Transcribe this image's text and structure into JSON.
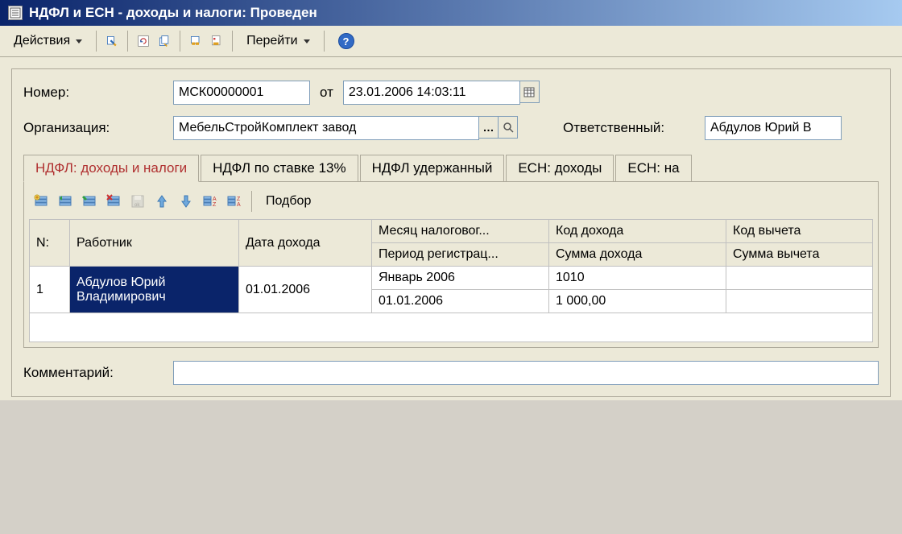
{
  "window": {
    "title": "НДФЛ и ЕСН - доходы и налоги: Проведен"
  },
  "toolbar": {
    "actions_label": "Действия",
    "goto_label": "Перейти"
  },
  "fields": {
    "number_label": "Номер:",
    "number_value": "МСК00000001",
    "from_label": "от",
    "date_value": "23.01.2006 14:03:11",
    "org_label": "Организация:",
    "org_value": "МебельСтройКомплект завод",
    "responsible_label": "Ответственный:",
    "responsible_value": "Абдулов Юрий В",
    "comment_label": "Комментарий:",
    "comment_value": ""
  },
  "tabs": {
    "tab1": "НДФЛ: доходы и налоги",
    "tab2": "НДФЛ по ставке 13%",
    "tab3": "НДФЛ удержанный",
    "tab4": "ЕСН: доходы",
    "tab5": "ЕСН: на"
  },
  "table_toolbar": {
    "select_label": "Подбор"
  },
  "table": {
    "headers": {
      "num": "N:",
      "employee": "Работник",
      "income_date": "Дата дохода",
      "tax_month": "Месяц налоговог...",
      "reg_period": "Период регистрац...",
      "income_code": "Код дохода",
      "income_sum": "Сумма дохода",
      "deduct_code": "Код вычета",
      "deduct_sum": "Сумма вычета"
    },
    "row": {
      "num": "1",
      "employee": "Абдулов Юрий Владимирович",
      "income_date": "01.01.2006",
      "tax_month": "Январь 2006",
      "reg_period": "01.01.2006",
      "income_code": "1010",
      "income_sum": "1 000,00",
      "deduct_code": "",
      "deduct_sum": ""
    }
  }
}
